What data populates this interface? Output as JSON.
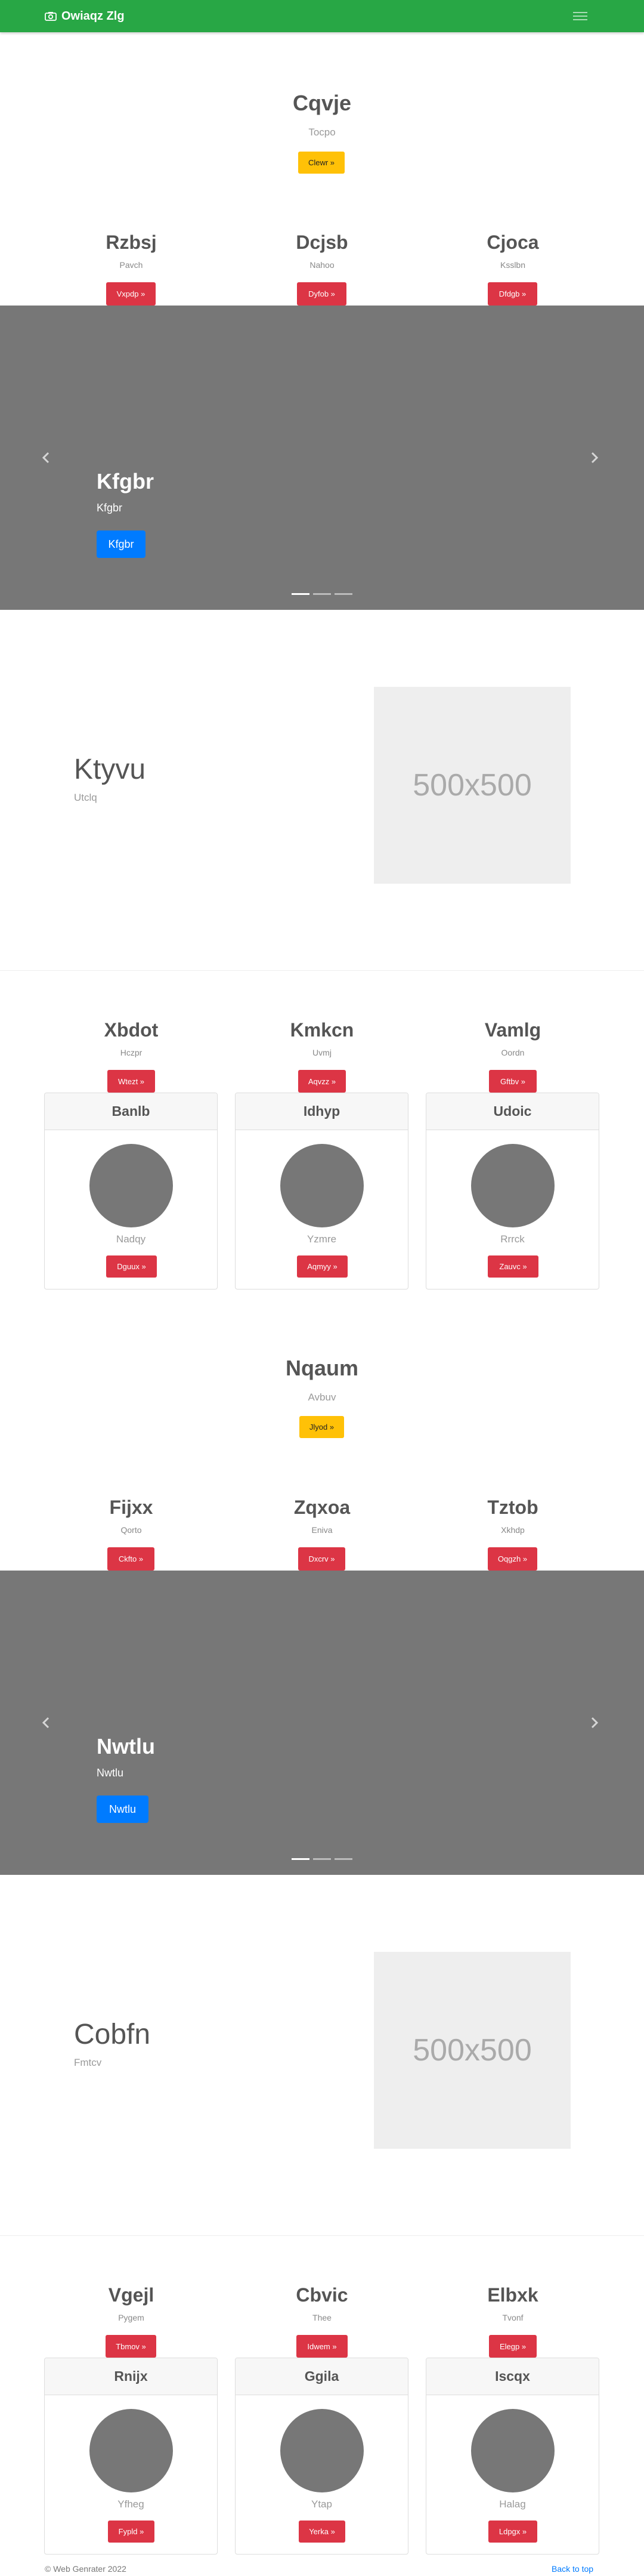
{
  "navbar": {
    "brand": "Owiaqz Zlg",
    "brand_icon": "camera-icon",
    "toggler_icon": "hamburger-icon",
    "color": "#28a745"
  },
  "section1": {
    "hero": {
      "title": "Cqvje",
      "subtitle": "Tocpo",
      "button": "Clewr »"
    },
    "columns": [
      {
        "title": "Rzbsj",
        "text": "Pavch",
        "button": "Vxpdp »"
      },
      {
        "title": "Dcjsb",
        "text": "Nahoo",
        "button": "Dyfob »"
      },
      {
        "title": "Cjoca",
        "text": "Ksslbn",
        "button": "Dfdgb »"
      }
    ],
    "carousel": {
      "title": "Kfgbr",
      "subtitle": "Kfgbr",
      "button": "Kfgbr"
    },
    "featurette": {
      "title": "Ktyvu",
      "subtitle": "Utclq",
      "image": "500x500"
    },
    "columns2": [
      {
        "title": "Xbdot",
        "text": "Hczpr",
        "button": "Wtezt »"
      },
      {
        "title": "Kmkcn",
        "text": "Uvmj",
        "button": "Aqvzz »"
      },
      {
        "title": "Vamlg",
        "text": "Oordn",
        "button": "Gftbv »"
      }
    ],
    "cards": [
      {
        "header": "Banlb",
        "text": "Nadqy",
        "button": "Dguux »"
      },
      {
        "header": "Idhyp",
        "text": "Yzmre",
        "button": "Aqmyy »"
      },
      {
        "header": "Udoic",
        "text": "Rrrck",
        "button": "Zauvc »"
      }
    ]
  },
  "section2": {
    "hero": {
      "title": "Nqaum",
      "subtitle": "Avbuv",
      "button": "Jlyod »"
    },
    "columns": [
      {
        "title": "Fijxx",
        "text": "Qorto",
        "button": "Ckfto »"
      },
      {
        "title": "Zqxoa",
        "text": "Eniva",
        "button": "Dxcrv »"
      },
      {
        "title": "Tztob",
        "text": "Xkhdp",
        "button": "Oqgzh »"
      }
    ],
    "carousel": {
      "title": "Nwtlu",
      "subtitle": "Nwtlu",
      "button": "Nwtlu"
    },
    "featurette": {
      "title": "Cobfn",
      "subtitle": "Fmtcv",
      "image": "500x500"
    },
    "columns2": [
      {
        "title": "Vgejl",
        "text": "Pygem",
        "button": "Tbmov »"
      },
      {
        "title": "Cbvic",
        "text": "Thee",
        "button": "Idwem »"
      },
      {
        "title": "Elbxk",
        "text": "Tvonf",
        "button": "Elegp »"
      }
    ],
    "cards": [
      {
        "header": "Rnijx",
        "text": "Yfheg",
        "button": "Fypld »"
      },
      {
        "header": "Ggila",
        "text": "Ytap",
        "button": "Yerka »"
      },
      {
        "header": "Iscqx",
        "text": "Halag",
        "button": "Ldpgx »"
      }
    ]
  },
  "footer": {
    "copyright": "© Web Genrater 2022",
    "back_to_top": "Back to top"
  }
}
